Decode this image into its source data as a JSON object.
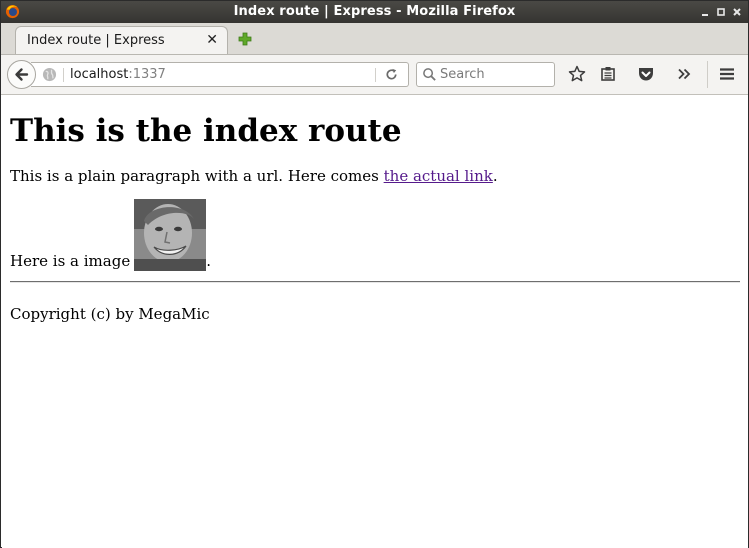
{
  "window": {
    "title": "Index route | Express - Mozilla Firefox",
    "controls": [
      "minimize-icon",
      "maximize-icon",
      "close-icon"
    ]
  },
  "tabs": [
    {
      "label": "Index route | Express",
      "active": true
    }
  ],
  "navbar": {
    "url_host": "localhost",
    "url_port": ":1337",
    "search_placeholder": "Search"
  },
  "page": {
    "heading": "This is the index route",
    "paragraph_text": "This is a plain paragraph with a url. Here comes ",
    "link_text": "the actual link",
    "paragraph_end": ".",
    "image_line_text": "Here is a image ",
    "image_line_end": ".",
    "footer": "Copyright (c) by MegaMic"
  },
  "colors": {
    "titlebar": "#3c3b37",
    "visited_link": "#551a8b",
    "toolbar": "#f4f3f1"
  }
}
